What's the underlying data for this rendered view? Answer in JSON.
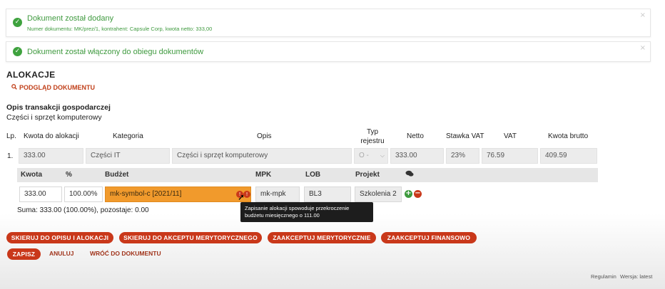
{
  "alerts": [
    {
      "title": "Dokument został dodany",
      "subtitle": "Numer dokumentu: MK/prez/1, kontrahent: Capsule Corp, kwota netto: 333,00"
    },
    {
      "title": "Dokument został włączony do obiegu dokumentów"
    }
  ],
  "section": {
    "title": "ALOKACJE",
    "preview_link": "PODGLĄD DOKUMENTU"
  },
  "description": {
    "label": "Opis transakcji gospodarczej",
    "value": "Części i sprzęt komputerowy"
  },
  "table": {
    "headers": {
      "lp": "Lp.",
      "amount": "Kwota do alokacji",
      "category": "Kategoria",
      "desc": "Opis",
      "register_type": "Typ rejestru",
      "netto": "Netto",
      "vat_rate": "Stawka VAT",
      "vat": "VAT",
      "gross": "Kwota brutto"
    },
    "row": {
      "lp": "1.",
      "amount": "333.00",
      "category": "Części IT",
      "desc": "Części i sprzęt komputerowy",
      "register_type": "O -",
      "netto": "333.00",
      "vat_rate": "23%",
      "vat": "76.59",
      "gross": "409.59"
    }
  },
  "allocation": {
    "headers": {
      "amount": "Kwota",
      "percent": "%",
      "budget": "Budżet",
      "mpk": "MPK",
      "lob": "LOB",
      "project": "Projekt"
    },
    "row": {
      "amount": "333.00",
      "percent": "100.00%",
      "budget": "mk-symbol-c [2021/11]",
      "mpk": "mk-mpk",
      "lob": "BL3",
      "project": "Szkolenia 2"
    },
    "tooltip": "Zapisanie alokacji spowoduje przekroczenie budżetu miesięcznego o 111.00",
    "summary": "Suma: 333.00 (100.00%), pozostaje: 0.00"
  },
  "buttons": {
    "send_to_allocation": "SKIERUJ DO OPISU I ALOKACJI",
    "send_to_approval": "SKIERUJ DO AKCEPTU MERYTORYCZNEGO",
    "approve_merit": "ZAAKCEPTUJ MERYTORYCZNIE",
    "approve_finance": "ZAAKCEPTUJ FINANSOWO",
    "save": "ZAPISZ",
    "cancel": "ANULUJ",
    "back": "WRÓĆ DO DOKUMENTU"
  },
  "footer": {
    "regulations": "Regulamin",
    "version": "Wersja: latest"
  },
  "colors": {
    "accent": "#c9381a",
    "success": "#3ea23e",
    "budget_warning": "#f19a2c"
  }
}
